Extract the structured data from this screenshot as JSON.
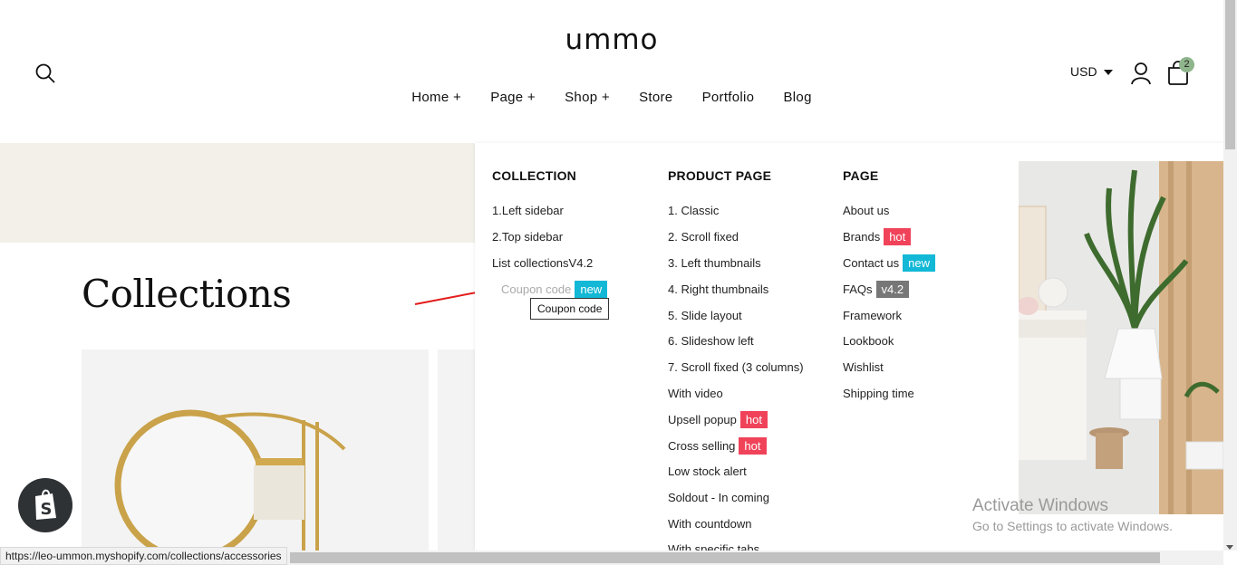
{
  "header": {
    "logo": "ummo",
    "currency": "USD",
    "cart_count": "2",
    "nav": [
      "Home +",
      "Page +",
      "Shop +",
      "Store",
      "Portfolio",
      "Blog"
    ]
  },
  "main": {
    "title": "Collections"
  },
  "mega_menu": {
    "collection": {
      "title": "COLLECTION",
      "items": [
        "1.Left sidebar",
        "2.Top sidebar",
        "List collectionsV4.2"
      ],
      "hovered_item": "Coupon code",
      "hovered_badge": "new",
      "tooltip": "Coupon code"
    },
    "product_page": {
      "title": "PRODUCT PAGE",
      "items": [
        {
          "label": "1. Classic",
          "badge": ""
        },
        {
          "label": "2. Scroll fixed",
          "badge": ""
        },
        {
          "label": "3. Left thumbnails",
          "badge": ""
        },
        {
          "label": "4. Right thumbnails",
          "badge": ""
        },
        {
          "label": "5. Slide layout",
          "badge": ""
        },
        {
          "label": "6. Slideshow left",
          "badge": ""
        },
        {
          "label": "7. Scroll fixed (3 columns)",
          "badge": ""
        },
        {
          "label": "With video",
          "badge": ""
        },
        {
          "label": "Upsell popup",
          "badge": "hot"
        },
        {
          "label": "Cross selling",
          "badge": "hot"
        },
        {
          "label": "Low stock alert",
          "badge": ""
        },
        {
          "label": "Soldout - In coming",
          "badge": ""
        },
        {
          "label": "With countdown",
          "badge": ""
        },
        {
          "label": "With specific tabs",
          "badge": ""
        }
      ]
    },
    "page": {
      "title": "PAGE",
      "items": [
        {
          "label": "About us",
          "badge": ""
        },
        {
          "label": "Brands",
          "badge": "hot"
        },
        {
          "label": "Contact us",
          "badge": "new"
        },
        {
          "label": "FAQs",
          "badge": "v4.2"
        },
        {
          "label": "Framework",
          "badge": ""
        },
        {
          "label": "Lookbook",
          "badge": ""
        },
        {
          "label": "Wishlist",
          "badge": ""
        },
        {
          "label": "Shipping time",
          "badge": ""
        }
      ]
    }
  },
  "status_bar": {
    "url": "https://leo-ummon.myshopify.com/collections/accessories"
  },
  "watermark": {
    "title": "Activate Windows",
    "subtitle": "Go to Settings to activate Windows."
  },
  "colors": {
    "hot": "#f0435a",
    "new": "#12b8d6",
    "version": "#777777",
    "hero_band": "#f3efe9"
  }
}
